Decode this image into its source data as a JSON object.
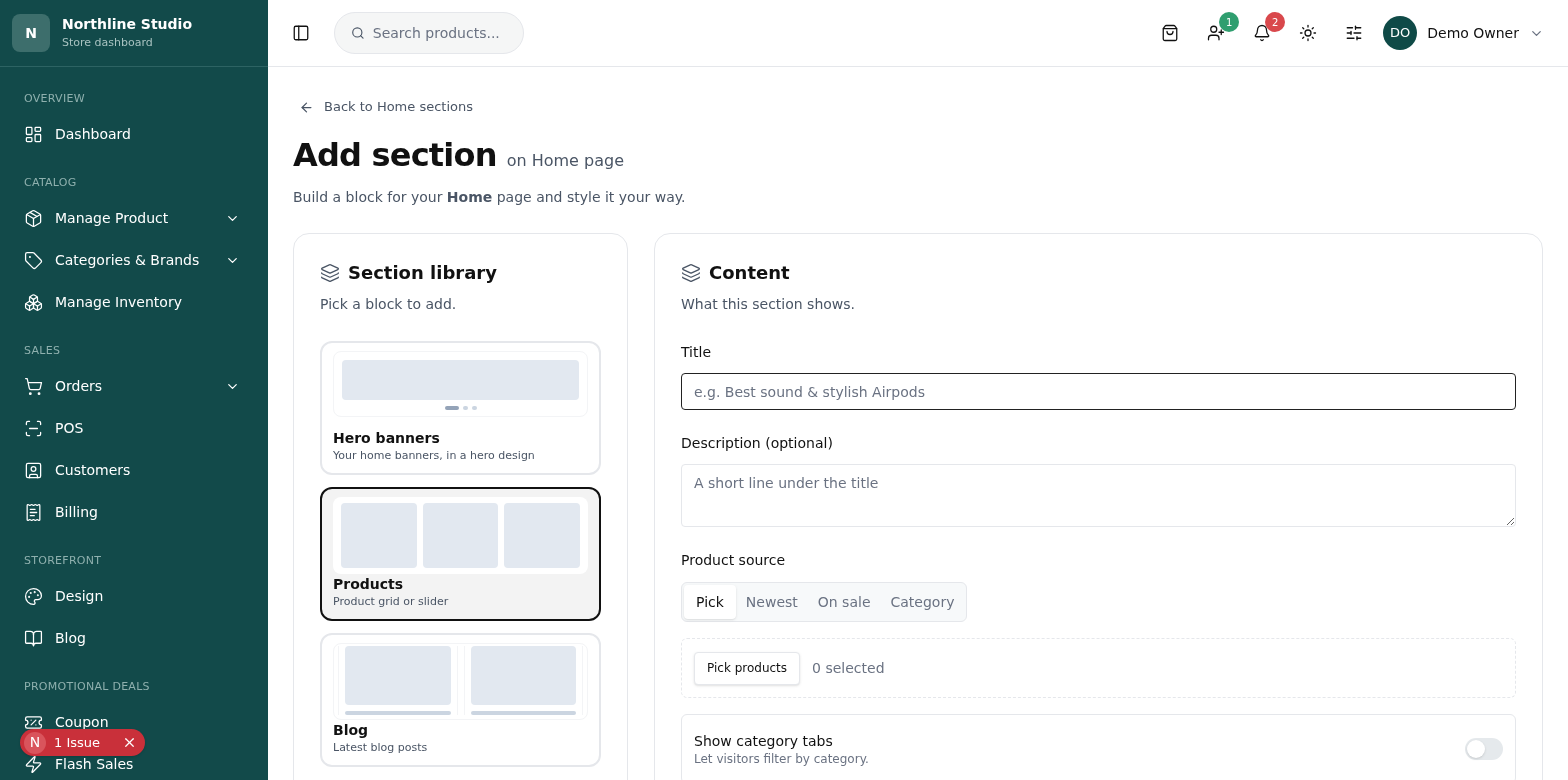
{
  "brand": {
    "initial": "N",
    "name": "Northline Studio",
    "subtitle": "Store dashboard"
  },
  "sidebar": {
    "sections": [
      {
        "title": "OVERVIEW",
        "items": [
          {
            "label": "Dashboard",
            "expandable": false
          }
        ]
      },
      {
        "title": "CATALOG",
        "items": [
          {
            "label": "Manage Product",
            "expandable": true
          },
          {
            "label": "Categories & Brands",
            "expandable": true
          },
          {
            "label": "Manage Inventory",
            "expandable": false
          }
        ]
      },
      {
        "title": "SALES",
        "items": [
          {
            "label": "Orders",
            "expandable": true
          },
          {
            "label": "POS",
            "expandable": false
          },
          {
            "label": "Customers",
            "expandable": false
          },
          {
            "label": "Billing",
            "expandable": false
          }
        ]
      },
      {
        "title": "STOREFRONT",
        "items": [
          {
            "label": "Design",
            "expandable": false
          },
          {
            "label": "Blog",
            "expandable": false
          }
        ]
      },
      {
        "title": "PROMOTIONAL DEALS",
        "items": [
          {
            "label": "Coupon",
            "expandable": false
          },
          {
            "label": "Flash Sales",
            "expandable": false
          }
        ]
      }
    ]
  },
  "issue_badge": {
    "initial": "N",
    "label": "1 Issue"
  },
  "header": {
    "search": {
      "placeholder": "Search products..."
    },
    "new_customers_count": "1",
    "notifications_count": "2",
    "user": {
      "initials": "DO",
      "name": "Demo Owner"
    }
  },
  "back_link": "Back to Home sections",
  "page_title": "Add section",
  "page_title_suffix": "on Home page",
  "page_subtitle": "Build a block for your **Home** page and style it your way.",
  "library": {
    "title": "Section library",
    "hint": "Pick a block to add.",
    "blocks": [
      {
        "kind": "hero",
        "title": "Hero banners",
        "description": "Your home banners, in a hero design",
        "selected": false
      },
      {
        "kind": "grid",
        "title": "Products",
        "description": "Product grid or slider",
        "selected": true
      },
      {
        "kind": "blog",
        "title": "Blog",
        "description": "Latest blog posts",
        "selected": false
      }
    ]
  },
  "content": {
    "title": "Content",
    "hint": "What this section shows.",
    "fields": [
      {
        "kind": "input",
        "label": "Title",
        "placeholder": "e.g. Best sound & stylish Airpods",
        "focused": true
      },
      {
        "kind": "textarea",
        "label": "Description (optional)",
        "placeholder": "A short line under the title",
        "focused": false
      }
    ],
    "product_source": {
      "label": "Product source",
      "options": [
        {
          "label": "Pick",
          "selected": true
        },
        {
          "label": "Newest",
          "selected": false
        },
        {
          "label": "On sale",
          "selected": false
        },
        {
          "label": "Category",
          "selected": false
        }
      ]
    },
    "pick_button": "Pick products",
    "selected_count": "0 selected",
    "toggles": [
      {
        "title": "Show category tabs",
        "description": "Let visitors filter by category.",
        "on": false
      }
    ]
  }
}
